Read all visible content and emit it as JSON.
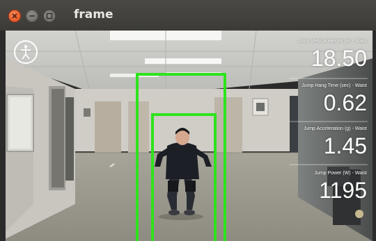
{
  "window": {
    "title": "frame",
    "close_icon": "close-icon",
    "minimize_icon": "minimize-icon",
    "maximize_icon": "maximize-icon"
  },
  "overlay": {
    "feature_icon": "person-skeleton-icon",
    "box_color": "#2ee31d",
    "metrics": [
      {
        "label": "Jump Vertical Height (in) - Waist",
        "value": "18.50"
      },
      {
        "label": "Jump Hang Time (sec) - Waist",
        "value": "0.62"
      },
      {
        "label": "Jump Acceleration (g) - Waist",
        "value": "1.45"
      },
      {
        "label": "Jump Power (W) - Waist",
        "value": "1195"
      }
    ]
  }
}
